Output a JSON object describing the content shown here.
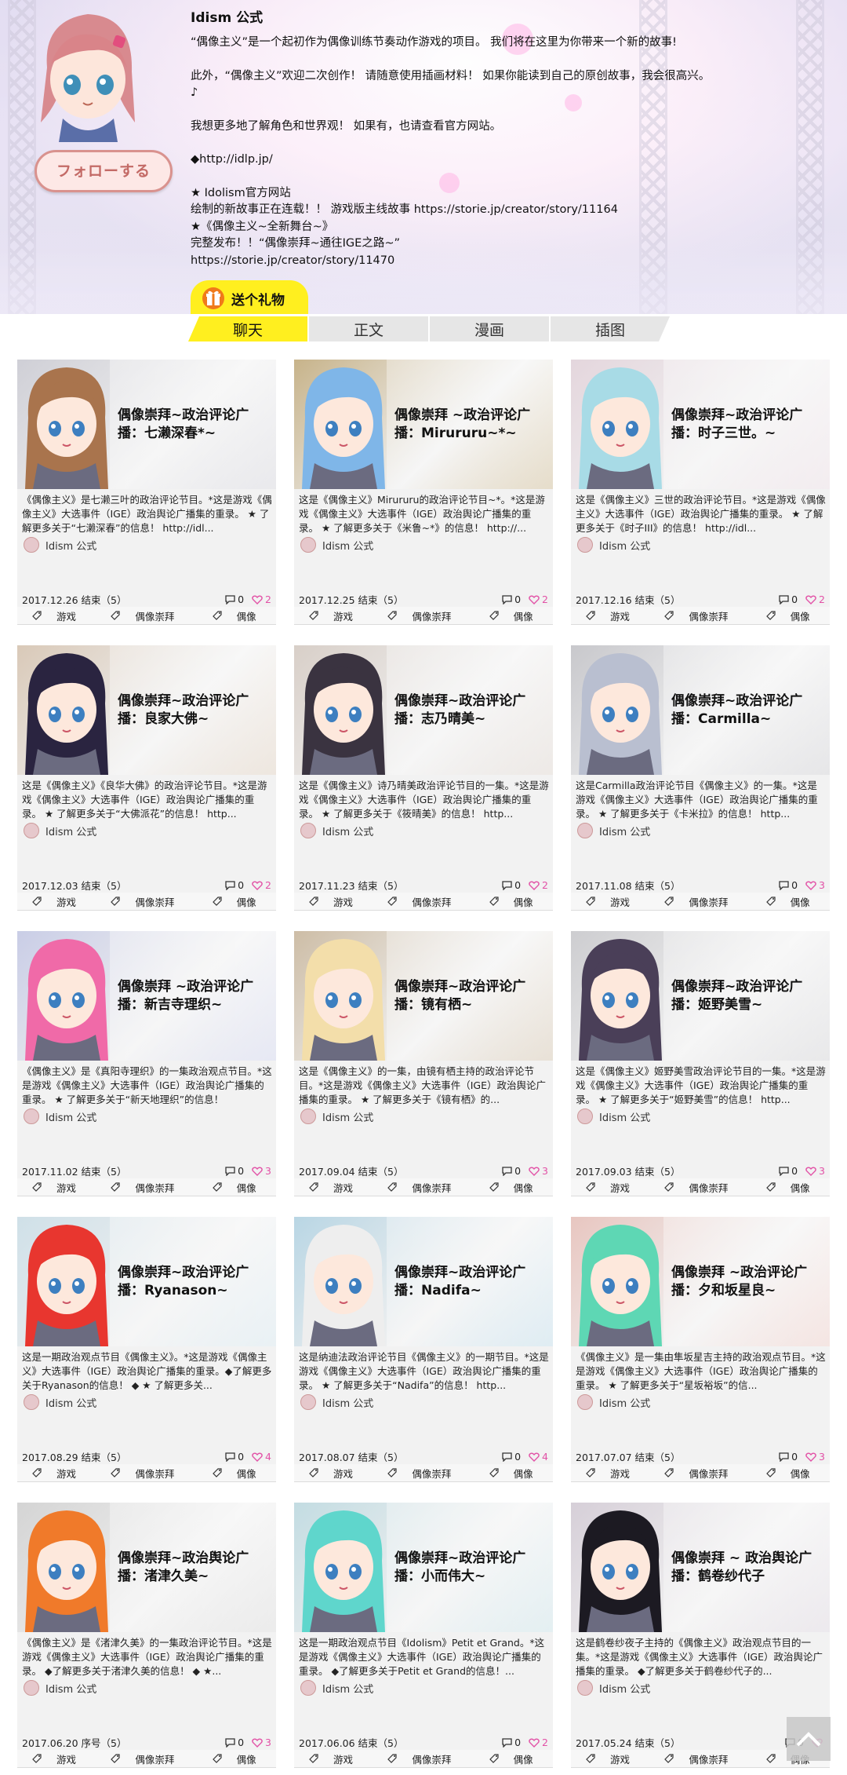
{
  "profile": {
    "name": "Idism 公式",
    "follow_label": "フォローする",
    "bio": [
      "“偶像主义”是一个起初作为偶像训练节奏动作游戏的项目。 我们将在这里为你带来一个新的故事!",
      "",
      "此外，“偶像主义”欢迎二次创作！ 请随意使用插画材料！ 如果你能读到自己的原创故事，我会很高兴。",
      "♪",
      "",
      "我想更多地了解角色和世界观！ 如果有，也请查看官方网站。",
      "",
      "◆http://idlp.jp/",
      "",
      "★ Idolism官方网站",
      "绘制的新故事正在连载！！ 游戏版主线故事 https://storie.jp/creator/story/11164",
      "★《偶像主义~全新舞台~》",
      "完整发布！！“偶像崇拜~通往IGE之路~”",
      "https://storie.jp/creator/story/11470"
    ],
    "gift_label": "送个礼物",
    "colors": {
      "accent_yellow": "#ffef1f",
      "follow_border": "#d9928e",
      "heart": "#e251a6"
    }
  },
  "tabs": [
    {
      "label": "聊天",
      "active": true
    },
    {
      "label": "正文",
      "active": false
    },
    {
      "label": "漫画",
      "active": false
    },
    {
      "label": "插图",
      "active": false
    }
  ],
  "cards": [
    {
      "title": "偶像崇拜~政治评论广播：七濑深春*~",
      "desc": "《偶像主义》是七濑三叶的政治评论节目。*这是游戏《偶像主义》大选事件（IGE）政治舆论广播集的重录。 ★ 了解更多关于“七濑深春”的信息！ http://idl...",
      "author": "Idism 公式",
      "date": "2017.12.26 结束（5）",
      "comments": "0",
      "likes": "2",
      "tags": [
        "游戏",
        "偶像崇拜",
        "偶像"
      ],
      "hair": "#a9744d",
      "bg": "#cfcfd6"
    },
    {
      "title": "偶像崇拜 ~政治评论广播：Mirururu~*~",
      "desc": "这是《偶像主义》Mirururu的政治评论节目~*。*这是游戏《偶像主义》大选事件（IGE）政治舆论广播集的重录。 ★ 了解更多关于《米鲁~*》的信息！ http://...",
      "author": "Idism 公式",
      "date": "2017.12.25 结束（5）",
      "comments": "0",
      "likes": "2",
      "tags": [
        "游戏",
        "偶像崇拜",
        "偶像"
      ],
      "hair": "#7fb6e8",
      "bg": "#c7b38a"
    },
    {
      "title": "偶像崇拜~政治评论广播：时子三世。~",
      "desc": "这是《偶像主义》三世的政治评论节目。*这是游戏《偶像主义》大选事件（IGE）政治舆论广播集的重录。 ★ 了解更多关于《时子III》的信息！ http://idl...",
      "author": "Idism 公式",
      "date": "2017.12.16 结束（5）",
      "comments": "0",
      "likes": "2",
      "tags": [
        "游戏",
        "偶像崇拜",
        "偶像"
      ],
      "hair": "#a8dbe6",
      "bg": "#e4d6dd"
    },
    {
      "title": "偶像崇拜~政治评论广播：良家大佛~",
      "desc": "这是《偶像主义》《良华大佛》的政治评论节目。*这是游戏《偶像主义》大选事件（IGE）政治舆论广播集的重录。 ★ 了解更多关于“大佛派花”的信息！ http...",
      "author": "Idism 公式",
      "date": "2017.12.03 结束（5）",
      "comments": "0",
      "likes": "2",
      "tags": [
        "游戏",
        "偶像崇拜",
        "偶像"
      ],
      "hair": "#2a2440",
      "bg": "#d9c9b8"
    },
    {
      "title": "偶像崇拜~政治评论广播：志乃晴美~",
      "desc": "这是《偶像主义》诗乃晴美政治评论节目的一集。*这是游戏《偶像主义》大选事件（IGE）政治舆论广播集的重录。 ★ 了解更多关于《筱晴美》的信息！ http...",
      "author": "Idism 公式",
      "date": "2017.11.23 结束（5）",
      "comments": "0",
      "likes": "2",
      "tags": [
        "游戏",
        "偶像崇拜",
        "偶像"
      ],
      "hair": "#3a3340",
      "bg": "#d8cfc8"
    },
    {
      "title": "偶像崇拜~政治评论广播：Carmilla~",
      "desc": "这是Carmilla政治评论节目《偶像主义》的一集。*这是游戏《偶像主义》大选事件（IGE）政治舆论广播集的重录。 ★ 了解更多关于《卡米拉》的信息！ http...",
      "author": "Idism 公式",
      "date": "2017.11.08 结束（5）",
      "comments": "0",
      "likes": "3",
      "tags": [
        "游戏",
        "偶像崇拜",
        "偶像"
      ],
      "hair": "#b9bfd0",
      "bg": "#c8c8cc"
    },
    {
      "title": "偶像崇拜 ~政治评论广播：新吉寺理织~",
      "desc": "《偶像主义》是《真阳寺理织》的一集政治观点节目。*这是游戏《偶像主义》大选事件（IGE）政治舆论广播集的重录。 ★ 了解更多关于“新天地理织”的信息！",
      "author": "Idism 公式",
      "date": "2017.11.02 结束（5）",
      "comments": "0",
      "likes": "3",
      "tags": [
        "游戏",
        "偶像崇拜",
        "偶像"
      ],
      "hair": "#f06aa8",
      "bg": "#c9cde6"
    },
    {
      "title": "偶像崇拜~政治评论广播：镜有栖~",
      "desc": "这是《偶像主义》的一集，由镜有栖主持的政治评论节目。*这是游戏《偶像主义》大选事件（IGE）政治舆论广播集的重录。 ★ 了解更多关于《镜有栖》的...",
      "author": "Idism 公式",
      "date": "2017.09.04 结束（5）",
      "comments": "0",
      "likes": "3",
      "tags": [
        "游戏",
        "偶像崇拜",
        "偶像"
      ],
      "hair": "#f3deaa",
      "bg": "#cdbda6"
    },
    {
      "title": "偶像崇拜~政治评论广播：姬野美雪~",
      "desc": "这是《偶像主义》姬野美雪政治评论节目的一集。*这是游戏《偶像主义》大选事件（IGE）政治舆论广播集的重录。 ★ 了解更多关于“姬野美雪”的信息！ http...",
      "author": "Idism 公式",
      "date": "2017.09.03 结束（5）",
      "comments": "0",
      "likes": "3",
      "tags": [
        "游戏",
        "偶像崇拜",
        "偶像"
      ],
      "hair": "#4a3f58",
      "bg": "#cdcdd0"
    },
    {
      "title": "偶像崇拜~政治评论广播：Ryanason~",
      "desc": "这是一期政治观点节目《偶像主义》。*这是游戏《偶像主义》大选事件（IGE）政治舆论广播集的重录。◆了解更多关于Ryanason的信息！ ◆ ★ 了解更多关...",
      "author": "Idism 公式",
      "date": "2017.08.29 结束（5）",
      "comments": "0",
      "likes": "4",
      "tags": [
        "游戏",
        "偶像崇拜",
        "偶像"
      ],
      "hair": "#e8362f",
      "bg": "#cfe0e8"
    },
    {
      "title": "偶像崇拜~政治评论广播：Nadifa~",
      "desc": "这是纳迪法政治评论节目《偶像主义》的一期节目。*这是游戏《偶像主义》大选事件（IGE）政治舆论广播集的重录。 ★ 了解更多关于“Nadifa”的信息！ http...",
      "author": "Idism 公式",
      "date": "2017.08.07 结束（5）",
      "comments": "0",
      "likes": "4",
      "tags": [
        "游戏",
        "偶像崇拜",
        "偶像"
      ],
      "hair": "#eeeeee",
      "bg": "#b9d6e4"
    },
    {
      "title": "偶像崇拜 ~政治评论广播：夕和坂星良~",
      "desc": "《偶像主义》是一集由隼坂星吉主持的政治观点节目。*这是游戏《偶像主义》大选事件（IGE）政治舆论广播集的重录。 ★ 了解更多关于“星坂裕坂”的信...",
      "author": "Idism 公式",
      "date": "2017.07.07 结束（5）",
      "comments": "0",
      "likes": "3",
      "tags": [
        "游戏",
        "偶像崇拜",
        "偶像"
      ],
      "hair": "#5ed7b4",
      "bg": "#e8c6c0"
    },
    {
      "title": "偶像崇拜~政治舆论广播：渚津久美~",
      "desc": "《偶像主义》是《渚津久美》的一集政治评论节目。*这是游戏《偶像主义》大选事件（IGE）政治舆论广播集的重录。 ◆了解更多关于渚津久美的信息！ ◆ ★...",
      "author": "Idism 公式",
      "date": "2017.06.20 序号（5）",
      "comments": "0",
      "likes": "3",
      "tags": [
        "游戏",
        "偶像崇拜",
        "偶像"
      ],
      "hair": "#f07a2a",
      "bg": "#d4d4d4"
    },
    {
      "title": "偶像崇拜~政治评论广播：小而伟大~",
      "desc": "这是一期政治观点节目《Idolism》Petit et Grand。*这是游戏《偶像主义》大选事件（IGE）政治舆论广播集的重录。 ◆了解更多关于Petit et Grand的信息！...",
      "author": "Idism 公式",
      "date": "2017.06.06 结束（5）",
      "comments": "0",
      "likes": "2",
      "tags": [
        "游戏",
        "偶像崇拜",
        "偶像"
      ],
      "hair": "#5fd6cc",
      "bg": "#c3dce2"
    },
    {
      "title": "偶像崇拜 ~ 政治舆论广播：鹤卷纱代子",
      "desc": "这是鹤卷纱夜子主持的《偶像主义》政治观点节目的一集。*这是游戏《偶像主义》大选事件（IGE）政治舆论广播集的重录。 ◆了解更多关于鹤卷纱代子的...",
      "author": "Idism 公式",
      "date": "2017.05.24 结束（5）",
      "comments": "0",
      "likes": "",
      "tags": [
        "游戏",
        "偶像崇拜",
        "偶像"
      ],
      "hair": "#1c1a22",
      "bg": "#d6cfd8"
    }
  ]
}
